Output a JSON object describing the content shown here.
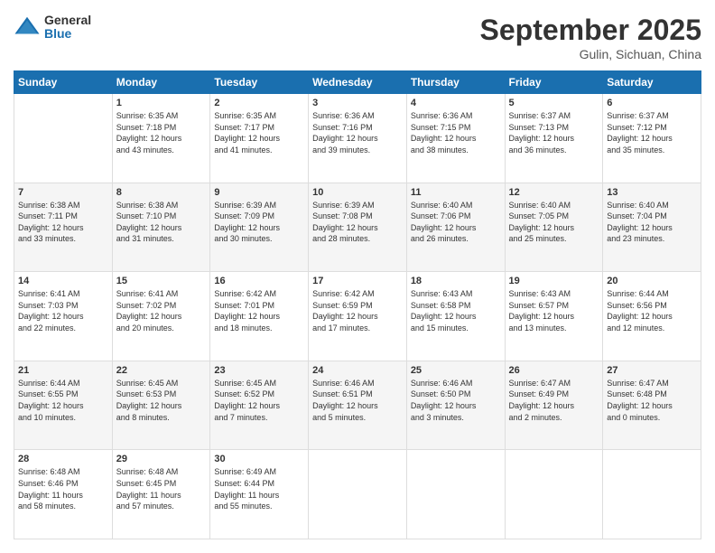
{
  "header": {
    "logo_general": "General",
    "logo_blue": "Blue",
    "month": "September 2025",
    "location": "Gulin, Sichuan, China"
  },
  "weekdays": [
    "Sunday",
    "Monday",
    "Tuesday",
    "Wednesday",
    "Thursday",
    "Friday",
    "Saturday"
  ],
  "weeks": [
    [
      {
        "day": "",
        "info": ""
      },
      {
        "day": "1",
        "info": "Sunrise: 6:35 AM\nSunset: 7:18 PM\nDaylight: 12 hours\nand 43 minutes."
      },
      {
        "day": "2",
        "info": "Sunrise: 6:35 AM\nSunset: 7:17 PM\nDaylight: 12 hours\nand 41 minutes."
      },
      {
        "day": "3",
        "info": "Sunrise: 6:36 AM\nSunset: 7:16 PM\nDaylight: 12 hours\nand 39 minutes."
      },
      {
        "day": "4",
        "info": "Sunrise: 6:36 AM\nSunset: 7:15 PM\nDaylight: 12 hours\nand 38 minutes."
      },
      {
        "day": "5",
        "info": "Sunrise: 6:37 AM\nSunset: 7:13 PM\nDaylight: 12 hours\nand 36 minutes."
      },
      {
        "day": "6",
        "info": "Sunrise: 6:37 AM\nSunset: 7:12 PM\nDaylight: 12 hours\nand 35 minutes."
      }
    ],
    [
      {
        "day": "7",
        "info": "Sunrise: 6:38 AM\nSunset: 7:11 PM\nDaylight: 12 hours\nand 33 minutes."
      },
      {
        "day": "8",
        "info": "Sunrise: 6:38 AM\nSunset: 7:10 PM\nDaylight: 12 hours\nand 31 minutes."
      },
      {
        "day": "9",
        "info": "Sunrise: 6:39 AM\nSunset: 7:09 PM\nDaylight: 12 hours\nand 30 minutes."
      },
      {
        "day": "10",
        "info": "Sunrise: 6:39 AM\nSunset: 7:08 PM\nDaylight: 12 hours\nand 28 minutes."
      },
      {
        "day": "11",
        "info": "Sunrise: 6:40 AM\nSunset: 7:06 PM\nDaylight: 12 hours\nand 26 minutes."
      },
      {
        "day": "12",
        "info": "Sunrise: 6:40 AM\nSunset: 7:05 PM\nDaylight: 12 hours\nand 25 minutes."
      },
      {
        "day": "13",
        "info": "Sunrise: 6:40 AM\nSunset: 7:04 PM\nDaylight: 12 hours\nand 23 minutes."
      }
    ],
    [
      {
        "day": "14",
        "info": "Sunrise: 6:41 AM\nSunset: 7:03 PM\nDaylight: 12 hours\nand 22 minutes."
      },
      {
        "day": "15",
        "info": "Sunrise: 6:41 AM\nSunset: 7:02 PM\nDaylight: 12 hours\nand 20 minutes."
      },
      {
        "day": "16",
        "info": "Sunrise: 6:42 AM\nSunset: 7:01 PM\nDaylight: 12 hours\nand 18 minutes."
      },
      {
        "day": "17",
        "info": "Sunrise: 6:42 AM\nSunset: 6:59 PM\nDaylight: 12 hours\nand 17 minutes."
      },
      {
        "day": "18",
        "info": "Sunrise: 6:43 AM\nSunset: 6:58 PM\nDaylight: 12 hours\nand 15 minutes."
      },
      {
        "day": "19",
        "info": "Sunrise: 6:43 AM\nSunset: 6:57 PM\nDaylight: 12 hours\nand 13 minutes."
      },
      {
        "day": "20",
        "info": "Sunrise: 6:44 AM\nSunset: 6:56 PM\nDaylight: 12 hours\nand 12 minutes."
      }
    ],
    [
      {
        "day": "21",
        "info": "Sunrise: 6:44 AM\nSunset: 6:55 PM\nDaylight: 12 hours\nand 10 minutes."
      },
      {
        "day": "22",
        "info": "Sunrise: 6:45 AM\nSunset: 6:53 PM\nDaylight: 12 hours\nand 8 minutes."
      },
      {
        "day": "23",
        "info": "Sunrise: 6:45 AM\nSunset: 6:52 PM\nDaylight: 12 hours\nand 7 minutes."
      },
      {
        "day": "24",
        "info": "Sunrise: 6:46 AM\nSunset: 6:51 PM\nDaylight: 12 hours\nand 5 minutes."
      },
      {
        "day": "25",
        "info": "Sunrise: 6:46 AM\nSunset: 6:50 PM\nDaylight: 12 hours\nand 3 minutes."
      },
      {
        "day": "26",
        "info": "Sunrise: 6:47 AM\nSunset: 6:49 PM\nDaylight: 12 hours\nand 2 minutes."
      },
      {
        "day": "27",
        "info": "Sunrise: 6:47 AM\nSunset: 6:48 PM\nDaylight: 12 hours\nand 0 minutes."
      }
    ],
    [
      {
        "day": "28",
        "info": "Sunrise: 6:48 AM\nSunset: 6:46 PM\nDaylight: 11 hours\nand 58 minutes."
      },
      {
        "day": "29",
        "info": "Sunrise: 6:48 AM\nSunset: 6:45 PM\nDaylight: 11 hours\nand 57 minutes."
      },
      {
        "day": "30",
        "info": "Sunrise: 6:49 AM\nSunset: 6:44 PM\nDaylight: 11 hours\nand 55 minutes."
      },
      {
        "day": "",
        "info": ""
      },
      {
        "day": "",
        "info": ""
      },
      {
        "day": "",
        "info": ""
      },
      {
        "day": "",
        "info": ""
      }
    ]
  ]
}
